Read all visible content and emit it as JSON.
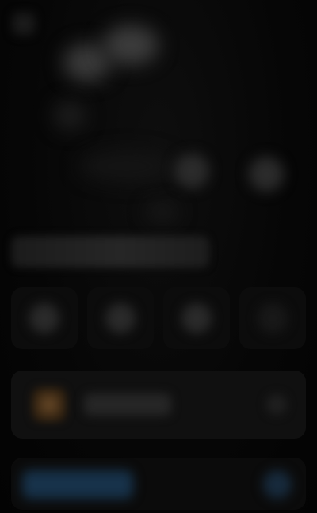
{
  "window": {
    "title": ""
  },
  "track": {
    "title": "",
    "subtitle": ""
  },
  "controls": {
    "items": [
      {
        "icon": "previous-icon"
      },
      {
        "icon": "play-icon"
      },
      {
        "icon": "next-icon"
      },
      {
        "icon": "more-icon"
      }
    ]
  },
  "now_playing": {
    "title": "",
    "icon": "more-icon"
  },
  "bottom": {
    "primary_label": "",
    "icon": "airplay-icon"
  },
  "colors": {
    "background": "#050505",
    "card": "#101010",
    "accent_blue": "#17324a",
    "artwork_orange": "#6a4a28"
  }
}
